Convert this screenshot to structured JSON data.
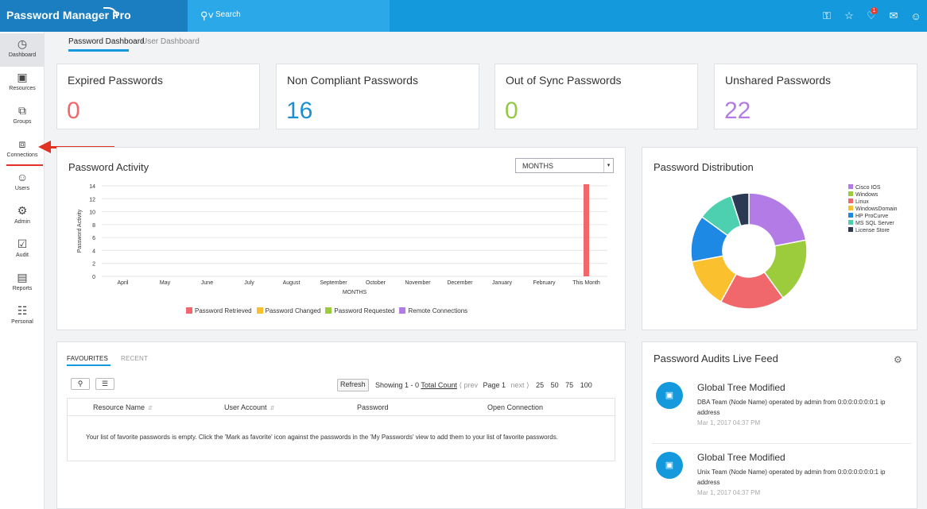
{
  "app": {
    "brand": "Password Manager Pro"
  },
  "search": {
    "label": "Search"
  },
  "topbar_icons": [
    "key-icon",
    "star-icon",
    "bell-icon",
    "mail-icon",
    "user-icon"
  ],
  "notifications": {
    "count": "1"
  },
  "sidebar": {
    "items": [
      {
        "label": "Dashboard",
        "icon": "dashboard-icon"
      },
      {
        "label": "Resources",
        "icon": "monitor-icon"
      },
      {
        "label": "Groups",
        "icon": "groups-icon"
      },
      {
        "label": "Connections",
        "icon": "connections-icon"
      },
      {
        "label": "Users",
        "icon": "user-icon"
      },
      {
        "label": "Admin",
        "icon": "gear-icon"
      },
      {
        "label": "Audit",
        "icon": "clipboard-check-icon"
      },
      {
        "label": "Reports",
        "icon": "bar-chart-icon"
      },
      {
        "label": "Personal",
        "icon": "address-book-icon"
      }
    ]
  },
  "tabs": {
    "active": "Password Dashboard",
    "inactive": "User Dashboard"
  },
  "stats": [
    {
      "title": "Expired Passwords",
      "value": "0",
      "color": "#f0686b"
    },
    {
      "title": "Non Compliant Passwords",
      "value": "16",
      "color": "#1b8fd2"
    },
    {
      "title": "Out of Sync Passwords",
      "value": "0",
      "color": "#93c947"
    },
    {
      "title": "Unshared Passwords",
      "value": "22",
      "color": "#b27be6"
    }
  ],
  "activity": {
    "title": "Password Activity",
    "select_value": "MONTHS"
  },
  "distribution": {
    "title": "Password Distribution"
  },
  "favourites": {
    "tab_active": "FAVOURITES",
    "tab_inactive": "RECENT",
    "refresh_label": "Refresh",
    "showing_label": "Showing 1 - 0",
    "total_count_label": "Total Count",
    "prev_label": "prev",
    "page_label": "Page 1",
    "next_label": "next",
    "page_sizes": [
      "25",
      "50",
      "75",
      "100"
    ],
    "columns": [
      "Resource Name",
      "User Account",
      "Password",
      "Open Connection"
    ],
    "empty_message": "Your list of favorite passwords is empty. Click the 'Mark as favorite' icon against the passwords in the 'My Passwords' view to add them to your list of favorite passwords."
  },
  "audits": {
    "title": "Password Audits Live Feed",
    "items": [
      {
        "title": "Global Tree Modified",
        "desc": "DBA Team (Node Name) operated by admin from 0:0:0:0:0:0:0:1 ip address",
        "time": "Mar 1, 2017 04:37 PM"
      },
      {
        "title": "Global Tree Modified",
        "desc": "Unix Team (Node Name) operated by admin from 0:0:0:0:0:0:0:1 ip address",
        "time": "Mar 1, 2017 04:37 PM"
      }
    ]
  },
  "chart_data": [
    {
      "type": "bar",
      "title": "Password Activity",
      "xlabel": "MONTHS",
      "ylabel": "Password Activity",
      "ylim": [
        0,
        14
      ],
      "yticks": [
        0,
        2,
        4,
        6,
        8,
        10,
        12,
        14
      ],
      "categories": [
        "April",
        "May",
        "June",
        "July",
        "August",
        "September",
        "October",
        "November",
        "December",
        "January",
        "February",
        "This Month"
      ],
      "grid": true,
      "legend_position": "bottom",
      "series": [
        {
          "name": "Password Retrieved",
          "color": "#f0686b",
          "values": [
            0,
            0,
            0,
            0,
            0,
            0,
            0,
            0,
            0,
            0,
            0,
            15
          ]
        },
        {
          "name": "Password Changed",
          "color": "#fbc02d",
          "values": [
            0,
            0,
            0,
            0,
            0,
            0,
            0,
            0,
            0,
            0,
            0,
            0
          ]
        },
        {
          "name": "Password Requested",
          "color": "#9ccc3c",
          "values": [
            0,
            0,
            0,
            0,
            0,
            0,
            0,
            0,
            0,
            0,
            0,
            0
          ]
        },
        {
          "name": "Remote Connections",
          "color": "#b27be6",
          "values": [
            0,
            0,
            0,
            0,
            0,
            0,
            0,
            0,
            0,
            0,
            0,
            0
          ]
        }
      ]
    },
    {
      "type": "pie",
      "title": "Password Distribution",
      "donut": true,
      "legend_position": "right",
      "labels": [
        "Cisco IOS",
        "Windows",
        "Linux",
        "WindowsDomain",
        "HP ProCurve",
        "MS SQL Server",
        "License Store"
      ],
      "colors": [
        "#b27be6",
        "#9ccc3c",
        "#f0686b",
        "#fbc02d",
        "#1e88e5",
        "#4dd0b0",
        "#2b3a52"
      ],
      "values": [
        22,
        18,
        18,
        14,
        13,
        10,
        5
      ]
    }
  ]
}
